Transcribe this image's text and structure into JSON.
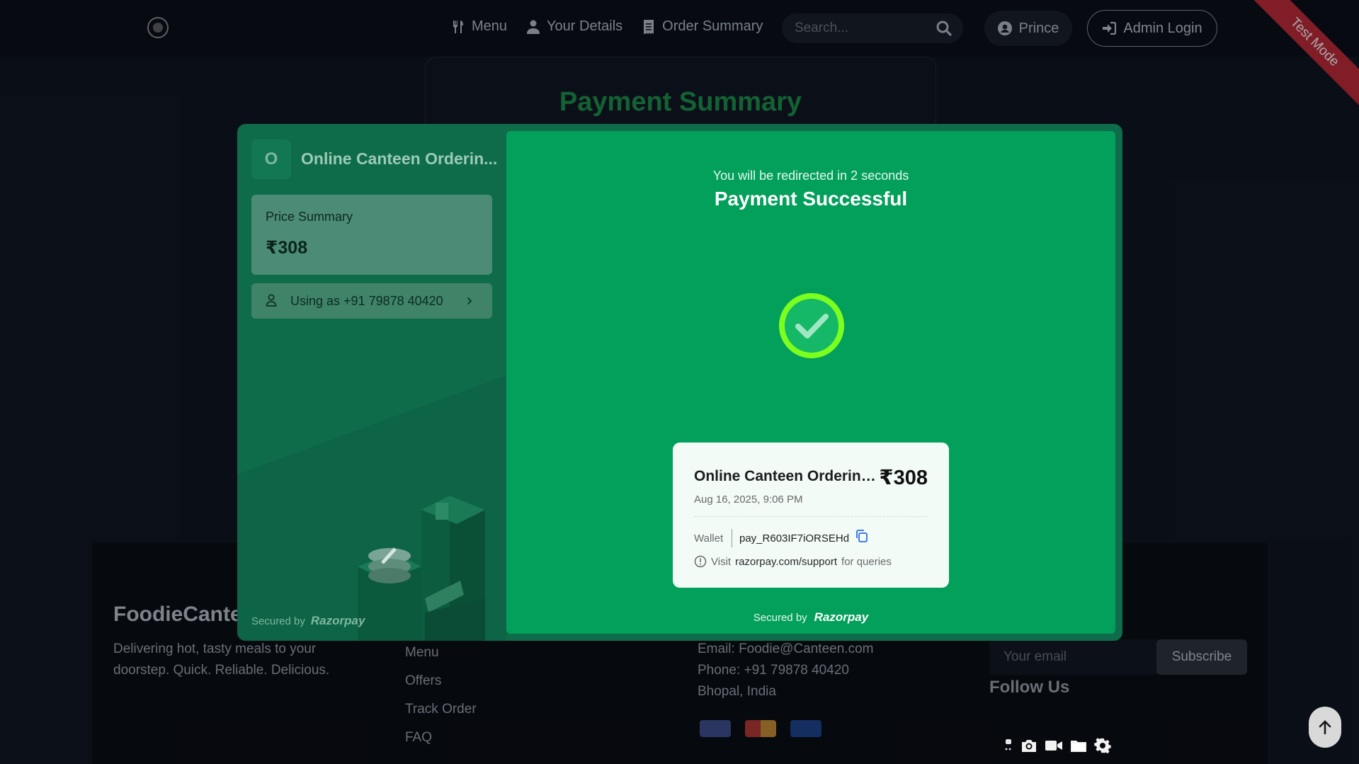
{
  "nav": {
    "menu": "Menu",
    "your_details": "Your Details",
    "order_summary": "Order Summary",
    "search_placeholder": "Search...",
    "user": "Prince",
    "admin_login": "Admin Login",
    "ribbon": "Test Mode"
  },
  "page": {
    "title": "Payment Summary"
  },
  "footer": {
    "brand": "FoodieCante",
    "tagline": "Delivering hot, tasty meals to your doorstep. Quick. Reliable. Delicious.",
    "links": [
      "Menu",
      "Offers",
      "Track Order",
      "FAQ"
    ],
    "email": "Email: Foodie@Canteen.com",
    "phone": "Phone: +91 79878 40420",
    "location": "Bhopal, India",
    "newsletter_placeholder": "Your email",
    "subscribe": "Subscribe",
    "follow_us": "Follow Us"
  },
  "checkout": {
    "merchant_initial": "O",
    "merchant_name": "Online Canteen Orderin...",
    "price_summary_label": "Price Summary",
    "price_value": "₹308",
    "using_as": "Using as +91 79878 40420",
    "secured_by": "Secured by",
    "brand": "Razorpay",
    "redirect_text": "You will be redirected in 2 seconds",
    "success_title": "Payment Successful",
    "receipt": {
      "merchant": "Online Canteen Ordering ...",
      "amount": "₹308",
      "date": "Aug 16, 2025, 9:06 PM",
      "method": "Wallet",
      "payment_id": "pay_R603IF7iORSEHd",
      "help_prefix": "Visit",
      "help_link": "razorpay.com/support",
      "help_suffix": "for queries"
    }
  },
  "colors": {
    "modal_bg": "#0f6c4a",
    "success_green": "#03a05b",
    "check_ring": "#7cff1f",
    "page_title": "#1a8f44",
    "ribbon": "#c2262e"
  }
}
